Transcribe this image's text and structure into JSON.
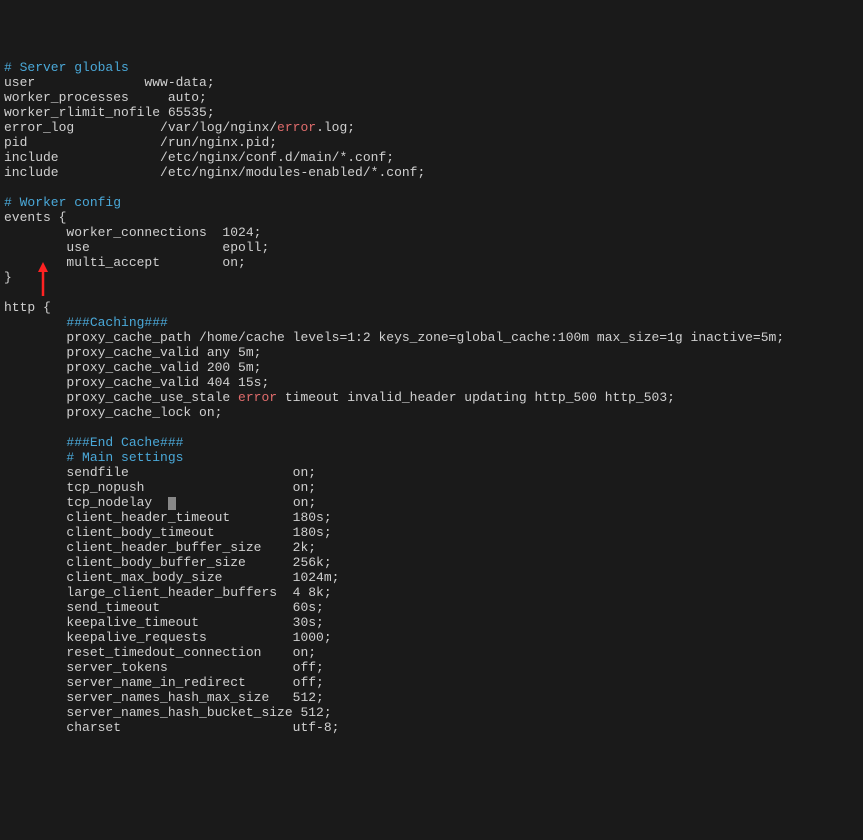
{
  "c1": "# Server globals",
  "l1": "user              www-data;",
  "l2": "worker_processes     auto;",
  "l3": "worker_rlimit_nofile 65535;",
  "l4a": "error_log           /var/log/nginx/",
  "l4err": "error",
  "l4b": ".log;",
  "l5": "pid                 /run/nginx.pid;",
  "l6": "include             /etc/nginx/conf.d/main/*.conf;",
  "l7": "include             /etc/nginx/modules-enabled/*.conf;",
  "c2": "# Worker config",
  "l8": "events {",
  "l9": "        worker_connections  1024;",
  "l10": "        use                 epoll;",
  "l11": "        multi_accept        on;",
  "l12": "}",
  "l13": "http {",
  "c3": "        ###Caching###",
  "l14": "        proxy_cache_path /home/cache levels=1:2 keys_zone=global_cache:100m max_size=1g inactive=5m;",
  "l15": "        proxy_cache_valid any 5m;",
  "l16": "        proxy_cache_valid 200 5m;",
  "l17": "        proxy_cache_valid 404 15s;",
  "l18a": "        proxy_cache_use_stale ",
  "l18err": "error",
  "l18b": " timeout invalid_header updating http_500 http_503;",
  "l19": "        proxy_cache_lock on;",
  "c4": "        ###End Cache###",
  "c5": "        # Main settings",
  "l20": "        sendfile                     on;",
  "l21": "        tcp_nopush                   on;",
  "l22a": "        tcp_nodelay  ",
  "l22b": "               on;",
  "l23": "        client_header_timeout        180s;",
  "l24": "        client_body_timeout          180s;",
  "l25": "        client_header_buffer_size    2k;",
  "l26": "        client_body_buffer_size      256k;",
  "l27": "        client_max_body_size         1024m;",
  "l28": "        large_client_header_buffers  4 8k;",
  "l29": "        send_timeout                 60s;",
  "l30": "        keepalive_timeout            30s;",
  "l31": "        keepalive_requests           1000;",
  "l32": "        reset_timedout_connection    on;",
  "l33": "        server_tokens                off;",
  "l34": "        server_name_in_redirect      off;",
  "l35": "        server_names_hash_max_size   512;",
  "l36": "        server_names_hash_bucket_size 512;",
  "l37": "        charset                      utf-8;"
}
